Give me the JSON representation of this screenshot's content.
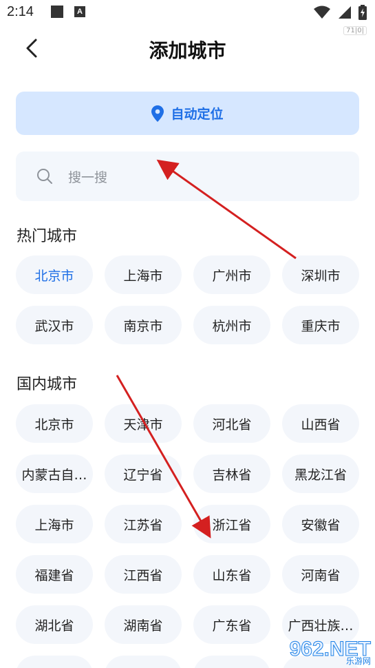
{
  "status": {
    "time": "2:14",
    "badge_letter": "A",
    "mini_chip": "71|0|"
  },
  "header": {
    "title": "添加城市"
  },
  "locate": {
    "label": "自动定位"
  },
  "search": {
    "placeholder": "搜一搜"
  },
  "hot": {
    "title": "热门城市",
    "cities": [
      "北京市",
      "上海市",
      "广州市",
      "深圳市",
      "武汉市",
      "南京市",
      "杭州市",
      "重庆市"
    ]
  },
  "domestic": {
    "title": "国内城市",
    "cities": [
      "北京市",
      "天津市",
      "河北省",
      "山西省",
      "内蒙古自…",
      "辽宁省",
      "吉林省",
      "黑龙江省",
      "上海市",
      "江苏省",
      "浙江省",
      "安徽省",
      "福建省",
      "江西省",
      "山东省",
      "河南省",
      "湖北省",
      "湖南省",
      "广东省",
      "广西壮族…",
      "",
      "",
      "",
      ""
    ]
  },
  "watermark": {
    "text": "962.NET",
    "sub": "乐游网"
  },
  "colors": {
    "accent": "#1f6fe6",
    "locate_bg": "#d6e7ff",
    "chip_bg": "#f3f6fb",
    "arrow": "#d42020"
  }
}
